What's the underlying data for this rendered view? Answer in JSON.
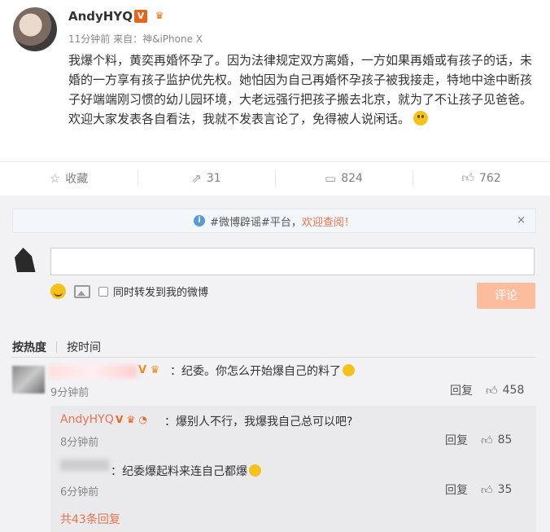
{
  "post": {
    "username": "AndyHYQ",
    "meta": "11分钟前 来自：神&iPhone X",
    "paragraphs": [
      "我爆个料，黄奕再婚怀孕了。因为法律规定双方离婚，一方如果再婚或有孩子的话，未婚的一方享有孩子监护优先权。她怕因为自己再婚怀孕孩子被我接走，特地中途中断孩子好端端刚习惯的幼儿园环境，大老远强行把孩子搬去北京，就为了不让孩子见爸爸。",
      "欢迎大家发表各自看法，我就不发表言论了，免得被人说闲话。"
    ]
  },
  "actions": {
    "favorite_label": "收藏",
    "repost_count": "31",
    "comment_count": "824",
    "like_count": "762"
  },
  "notice": {
    "text_prefix": "#微博辟谣#平台，",
    "link_text": "欢迎查阅！",
    "close": "×"
  },
  "composer": {
    "repost_label": "同时转发到我的微博",
    "submit_label": "评论"
  },
  "sort": {
    "hot": "按热度",
    "time": "按时间"
  },
  "comment": {
    "text": "：纪委。你怎么开始爆自己的料了",
    "time": "9分钟前",
    "reply_label": "回复",
    "likes": "458"
  },
  "replies": [
    {
      "name": "AndyHYQ",
      "text": "：爆别人不行，我爆我自己总可以吧?",
      "time": "8分钟前",
      "reply_label": "回复",
      "likes": "85"
    },
    {
      "text": "：纪委爆起料来连自己都爆",
      "time": "6分钟前",
      "reply_label": "回复",
      "likes": "35"
    }
  ],
  "more_replies": "共43条回复"
}
